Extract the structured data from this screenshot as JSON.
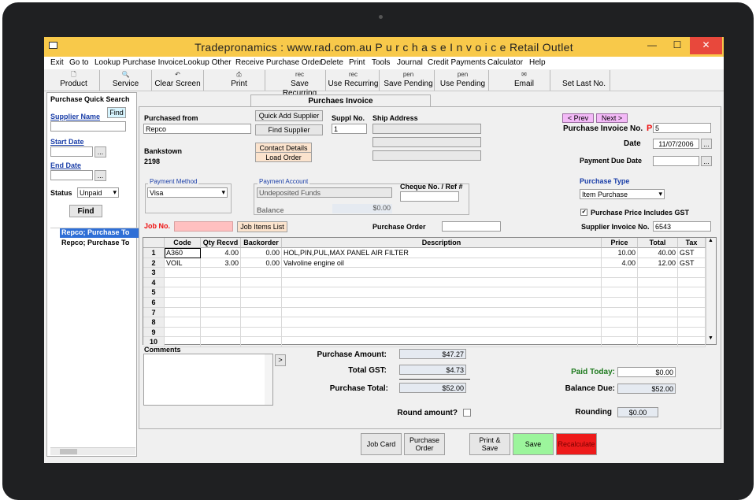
{
  "window": {
    "title": "Tradepronamics :  www.rad.com.au   P u r c h a s e  I n v o i c e   Retail Outlet",
    "minimize": "—",
    "maximize": "☐",
    "close": "✕"
  },
  "menu": [
    "Exit",
    "Go to",
    "Lookup Purchase Invoice",
    "Lookup Other",
    "Receive Purchase Order",
    "Delete",
    "Print",
    "Tools",
    "Journal",
    "Credit Payments",
    "Calculator",
    "Help"
  ],
  "toolbar": {
    "product": "Product",
    "service": "Service",
    "clear": "Clear Screen",
    "print": "Print",
    "save_recurring": "Save Recurring",
    "use_recurring": "Use Recurring",
    "save_pending": "Save Pending",
    "use_pending": "Use Pending",
    "email": "Email",
    "set_last": "Set Last No.",
    "rec": "rec",
    "pen": "pen"
  },
  "quick_search": {
    "title": "Purchase Quick Search",
    "supplier_label": "Supplier Name",
    "find_small": "Find",
    "start_label": "Start Date",
    "end_label": "End Date",
    "status_label": "Status",
    "status_value": "Unpaid",
    "find": "Find",
    "browse": "...",
    "results": [
      "Repco; Purchase To",
      "Repco; Purchase To"
    ]
  },
  "form": {
    "tab_title": "Purchaes Invoice",
    "purchased_from_label": "Purchased from",
    "purchased_from": "Repco",
    "quick_add": "Quick Add Supplier",
    "find_supplier": "Find Supplier",
    "suppl_label": "Suppl No.",
    "suppl_no": "1",
    "ship_label": "Ship Address",
    "suburb": "Bankstown",
    "postcode": "2198",
    "contact": "Contact Details",
    "load_order": "Load Order",
    "prev": "< Prev",
    "next": "Next >",
    "invoice_no_label": "Purchase Invoice No.",
    "invoice_prefix": "P",
    "invoice_no": "5",
    "date_label": "Date",
    "date": "11/07/2006",
    "due_label": "Payment Due Date",
    "browse": "...",
    "pm_label": "Payment Method",
    "pm_value": "Visa",
    "pa_label": "Payment Account",
    "pa_value": "Undeposited Funds",
    "cheque_label": "Cheque No. / Ref #",
    "balance_label": "Balance",
    "balance": "$0.00",
    "ptype_label": "Purchase Type",
    "ptype_value": "Item Purchase",
    "incl_gst": "Purchase Price Includes GST",
    "check_mark": "✔",
    "job_label": "Job No.",
    "job_items": "Job Items List",
    "po_label": "Purchase Order",
    "sup_inv_label": "Supplier Invoice No.",
    "sup_inv": "6543"
  },
  "grid": {
    "headers": [
      "Code",
      "Qty Recvd",
      "Backorder",
      "Description",
      "Price",
      "Total",
      "Tax"
    ],
    "rows": [
      {
        "n": "1",
        "code": "A360",
        "qty": "4.00",
        "bo": "0.00",
        "desc": "HOL,PIN,PUL,MAX PANEL AIR FILTER",
        "price": "10.00",
        "total": "40.00",
        "tax": "GST"
      },
      {
        "n": "2",
        "code": "VOIL",
        "qty": "3.00",
        "bo": "0.00",
        "desc": "Valvoline engine oil",
        "price": "4.00",
        "total": "12.00",
        "tax": "GST"
      },
      {
        "n": "3"
      },
      {
        "n": "4"
      },
      {
        "n": "5"
      },
      {
        "n": "6"
      },
      {
        "n": "7"
      },
      {
        "n": "8"
      },
      {
        "n": "9"
      },
      {
        "n": "10"
      }
    ],
    "scroll_up": "▲",
    "scroll_down": "▼"
  },
  "totals": {
    "comments_label": "Comments",
    "arrow": ">",
    "pa_label": "Purchase Amount:",
    "pa": "$47.27",
    "gst_label": "Total GST:",
    "gst": "$4.73",
    "pt_label": "Purchase Total:",
    "pt": "$52.00",
    "round_label": "Round amount?",
    "paid_label": "Paid Today:",
    "paid": "$0.00",
    "due_label": "Balance Due:",
    "due": "$52.00",
    "rounding_label": "Rounding",
    "rounding": "$0.00"
  },
  "footer": {
    "job_card": "Job Card",
    "po": "Purchase Order",
    "print_save": "Print & Save",
    "save": "Save",
    "recalc": "Recalculate"
  },
  "colors": {
    "title": "#f8c94a",
    "save": "#9cf59c",
    "recalc": "#ee1b1b",
    "paid": "#1e7a1e",
    "nav": "#f3b9f7"
  }
}
